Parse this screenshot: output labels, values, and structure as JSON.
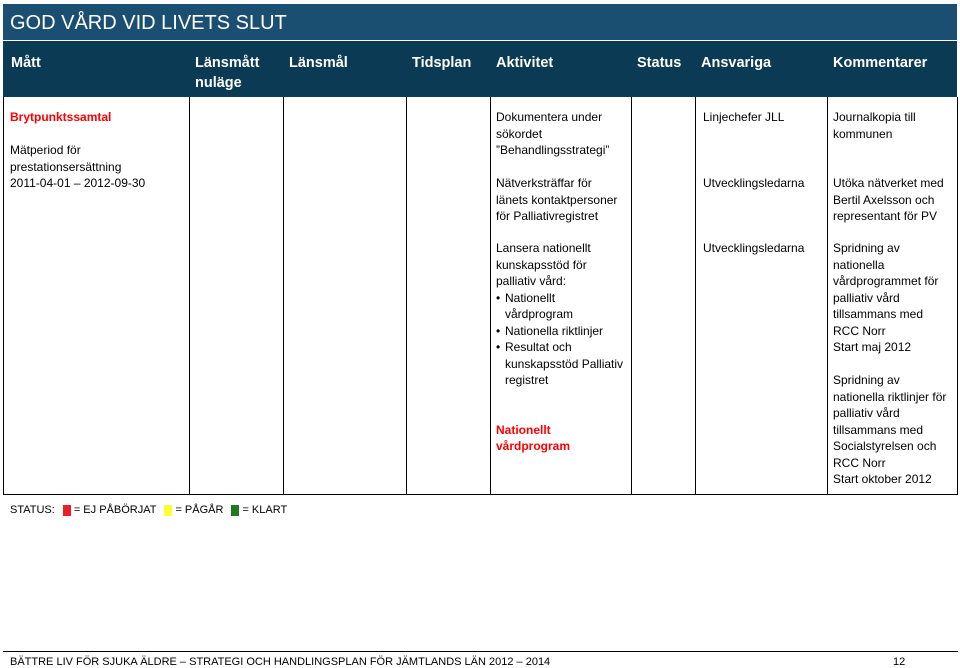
{
  "page": {
    "title": "GOD VÅRD VID LIVETS SLUT"
  },
  "header": {
    "matt": "Mått",
    "lansmatt_nulage_1": "Länsmått",
    "lansmatt_nulage_2": "nuläge",
    "lansmal": "Länsmål",
    "tidsplan": "Tidsplan",
    "aktivitet": "Aktivitet",
    "status": "Status",
    "ansvariga": "Ansvariga",
    "kommentarer": "Kommentarer"
  },
  "row1": {
    "matt_title": "Brytpunktssamtal",
    "matt_l1": "Mätperiod för",
    "matt_l2": "prestationsersättning",
    "matt_l3": "2011-04-01 – 2012-09-30",
    "akt_l1": "Dokumentera under",
    "akt_l2": "sökordet",
    "akt_l3": "”Behandlingsstrategi”",
    "akt_l4": "Nätverksträffar för",
    "akt_l5": "länets kontaktpersoner",
    "akt_l6": "för Palliativregistret",
    "ansv_1": "Linjechefer JLL",
    "ansv_2": "Utvecklingsledarna",
    "komm_l1": "Journalkopia till",
    "komm_l2": "kommunen",
    "komm_l3": "Utöka nätverket med",
    "komm_l4": "Bertil Axelsson och",
    "komm_l5": "representant för PV"
  },
  "row2": {
    "akt_l1": "Lansera nationellt",
    "akt_l2": "kunskapsstöd för",
    "akt_l3": "palliativ vård:",
    "bullet_1a": "Nationellt",
    "bullet_1b": "vårdprogram",
    "bullet_2": "Nationella riktlinjer",
    "bullet_3a": "Resultat och",
    "bullet_3b": "kunskapsstöd Palliativ",
    "bullet_3c": "registret",
    "red_l1": "Nationellt",
    "red_l2": "vårdprogram",
    "ansv": "Utvecklingsledarna",
    "komm_l1": "Spridning av",
    "komm_l2": "nationella",
    "komm_l3": "vårdprogrammet för",
    "komm_l4": "palliativ vård",
    "komm_l5": "tillsammans med",
    "komm_l6": "RCC Norr",
    "komm_l7": "Start maj 2012",
    "komm_l8": "Spridning av",
    "komm_l9": "nationella riktlinjer för",
    "komm_l10": "palliativ vård",
    "komm_l11": "tillsammans med",
    "komm_l12": "Socialstyrelsen och",
    "komm_l13": "RCC Norr",
    "komm_l14": "Start oktober 2012"
  },
  "legend": {
    "label": "STATUS:",
    "red_label": "= EJ PÅBÖRJAT",
    "yellow_label": "= PÅGÅR",
    "green_label": "= KLART",
    "colors": {
      "red": "#e8202a",
      "yellow": "#ffff33",
      "green": "#1f7a1f"
    }
  },
  "footer": {
    "text": "BÄTTRE LIV FÖR SJUKA ÄLDRE – STRATEGI OCH HANDLINGSPLAN FÖR JÄMTLANDS LÄN 2012 – 2014",
    "page_number": "12"
  }
}
